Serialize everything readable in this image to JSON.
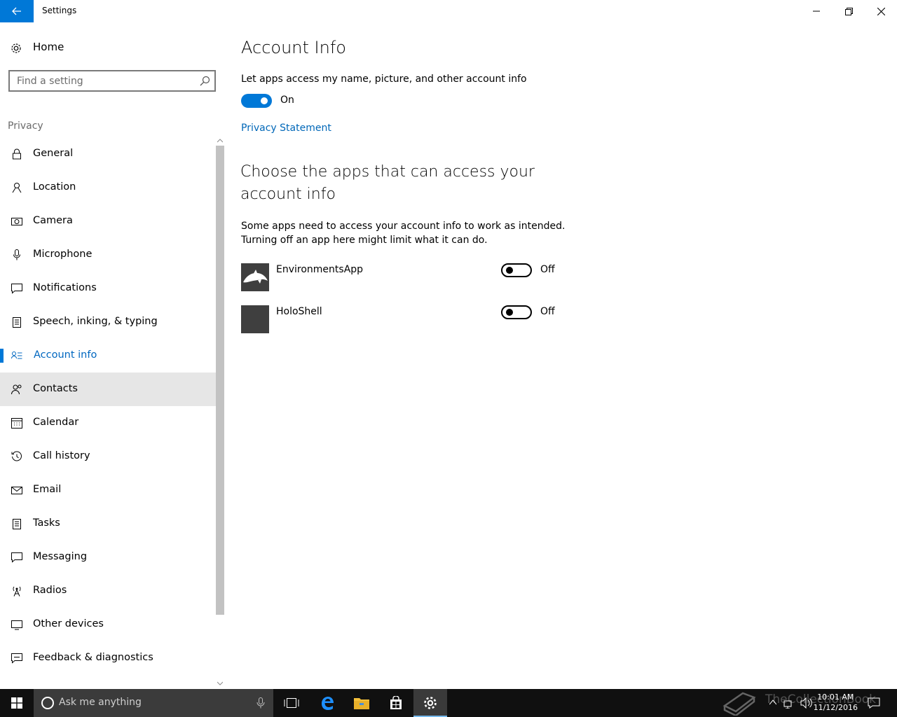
{
  "window": {
    "title": "Settings"
  },
  "sidebar": {
    "home_label": "Home",
    "search_placeholder": "Find a setting",
    "section_label": "Privacy",
    "items": [
      {
        "label": "General",
        "icon": "lock-icon"
      },
      {
        "label": "Location",
        "icon": "location-icon"
      },
      {
        "label": "Camera",
        "icon": "camera-icon"
      },
      {
        "label": "Microphone",
        "icon": "microphone-icon"
      },
      {
        "label": "Notifications",
        "icon": "notifications-icon"
      },
      {
        "label": "Speech, inking, & typing",
        "icon": "speech-icon"
      },
      {
        "label": "Account info",
        "icon": "account-info-icon",
        "selected": true
      },
      {
        "label": "Contacts",
        "icon": "contacts-icon",
        "hover": true
      },
      {
        "label": "Calendar",
        "icon": "calendar-icon"
      },
      {
        "label": "Call history",
        "icon": "call-history-icon"
      },
      {
        "label": "Email",
        "icon": "email-icon"
      },
      {
        "label": "Tasks",
        "icon": "tasks-icon"
      },
      {
        "label": "Messaging",
        "icon": "messaging-icon"
      },
      {
        "label": "Radios",
        "icon": "radios-icon"
      },
      {
        "label": "Other devices",
        "icon": "other-devices-icon"
      },
      {
        "label": "Feedback & diagnostics",
        "icon": "feedback-icon"
      }
    ]
  },
  "main": {
    "title": "Account Info",
    "toggle_description": "Let apps access my name, picture, and other account info",
    "toggle_state": "On",
    "privacy_link": "Privacy Statement",
    "section_heading": "Choose the apps that can access your account info",
    "section_description_line1": "Some apps need to access your account info to work as intended.",
    "section_description_line2": "Turning off an app here might limit what it can do.",
    "apps": [
      {
        "name": "EnvironmentsApp",
        "state": "Off"
      },
      {
        "name": "HoloShell",
        "state": "Off"
      }
    ]
  },
  "taskbar": {
    "search_placeholder": "Ask me anything",
    "time": "10:01 AM",
    "date": "11/12/2016",
    "watermark": "TheCollectionBook"
  },
  "colors": {
    "accent": "#0078d7",
    "link": "#0067b8",
    "taskbar": "#101010"
  }
}
